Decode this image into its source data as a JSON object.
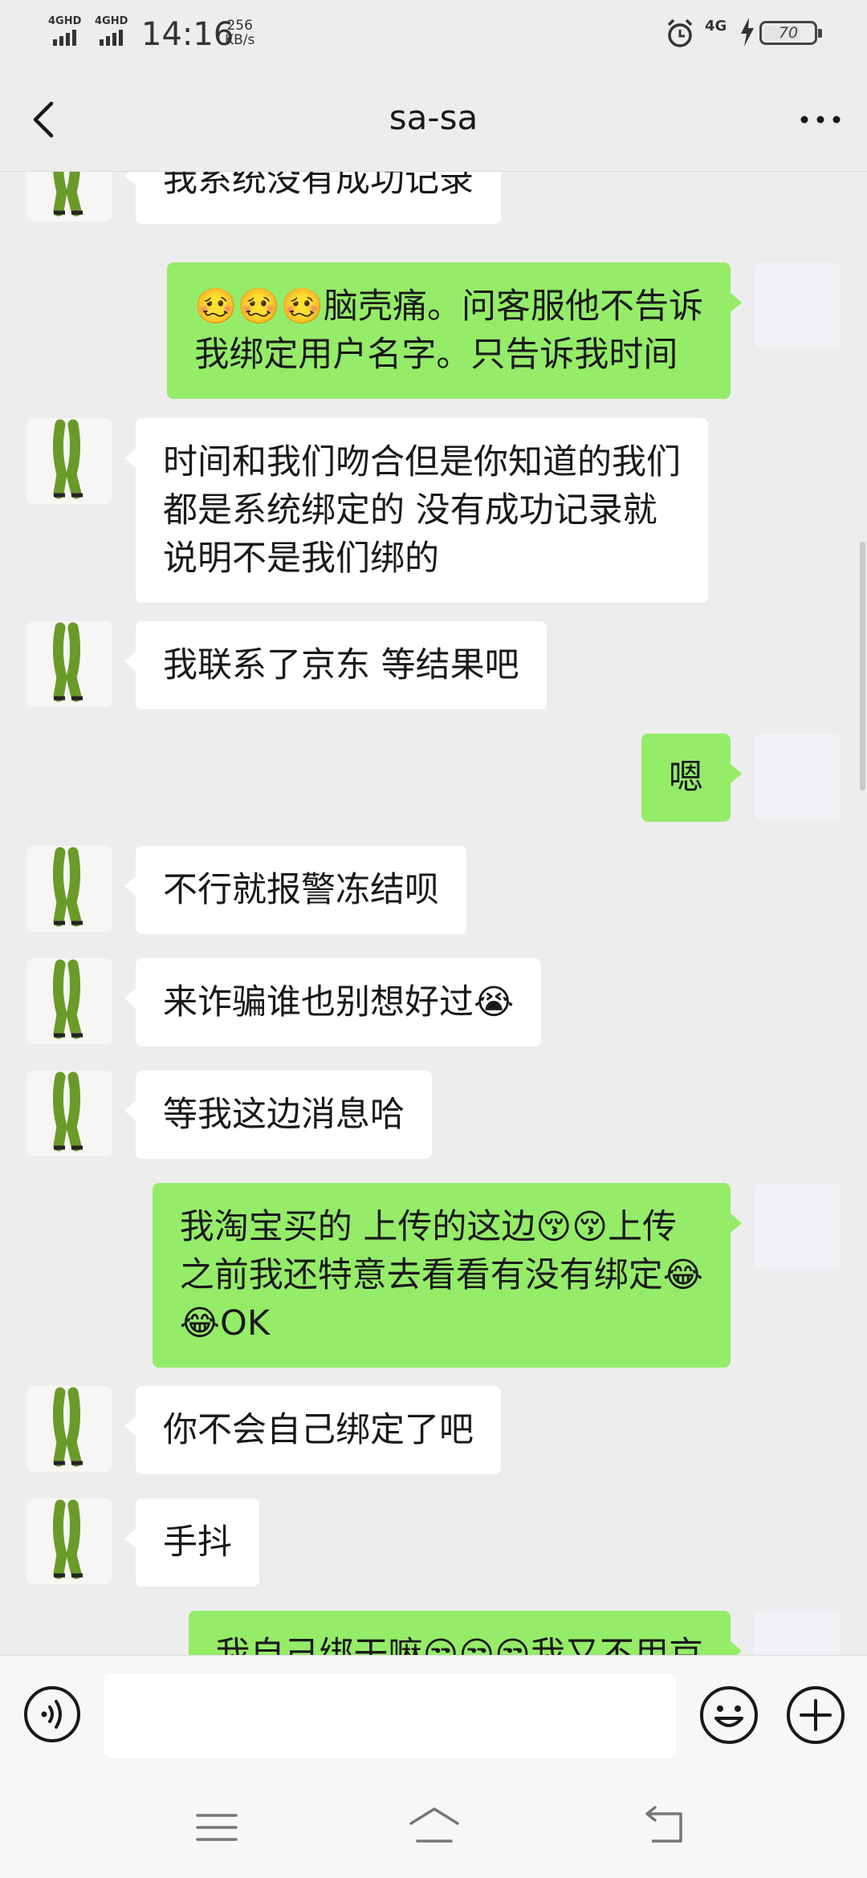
{
  "status_bar": {
    "signal1_label": "4GHD",
    "signal2_label": "4GHD",
    "time": "14:16",
    "speed_value": "256",
    "speed_unit": "KB/s",
    "network": "4G",
    "battery": "70"
  },
  "header": {
    "title": "sa-sa"
  },
  "messages": [
    {
      "side": "left",
      "text": "我系统没有成功记录"
    },
    {
      "side": "right",
      "text": "🥴🥴🥴脑壳痛。问客服他不告诉\n我绑定用户名字。只告诉我时间"
    },
    {
      "side": "left",
      "text": "时间和我们吻合但是你知道的我们\n都是系统绑定的 没有成功记录就\n说明不是我们绑的"
    },
    {
      "side": "left",
      "text": "我联系了京东 等结果吧"
    },
    {
      "side": "right",
      "text": "嗯"
    },
    {
      "side": "left",
      "text": "不行就报警冻结呗"
    },
    {
      "side": "left",
      "text": "来诈骗谁也别想好过😭"
    },
    {
      "side": "left",
      "text": "等我这边消息哈"
    },
    {
      "side": "right",
      "text": "我淘宝买的 上传的这边😚😚上传\n之前我还特意去看看有没有绑定😂\n😂OK"
    },
    {
      "side": "left",
      "text": "你不会自己绑定了吧"
    },
    {
      "side": "left",
      "text": "手抖"
    },
    {
      "side": "right",
      "text": "我自己绑干嘛😒😒😒我又不用京"
    }
  ],
  "input": {
    "value": ""
  },
  "colors": {
    "background": "#ededed",
    "bubble_self": "#95ec69",
    "bubble_other": "#ffffff"
  }
}
